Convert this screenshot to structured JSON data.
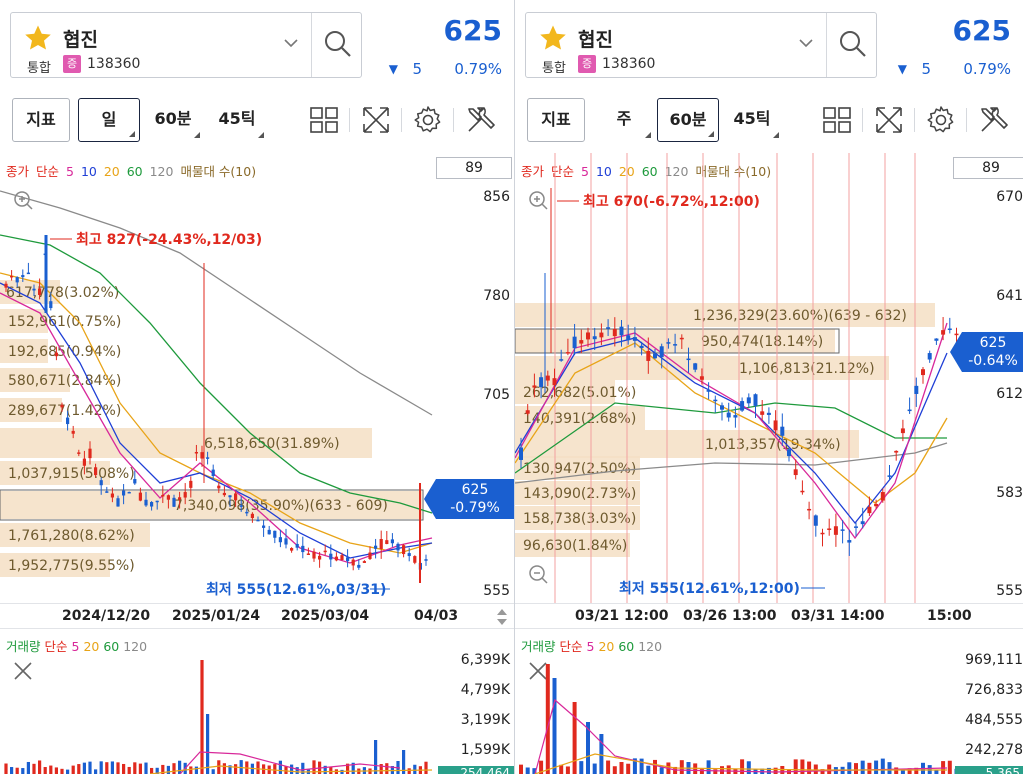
{
  "left": {
    "stock": {
      "name": "협진",
      "market": "통합",
      "badge": "증",
      "code": "138360"
    },
    "price": "625",
    "change_arrow": "▼",
    "change": "5",
    "change_pct": "0.79%",
    "toolbar": {
      "indicator": "지표",
      "period": "일",
      "minute": "60분",
      "tick": "45틱",
      "active": "일"
    },
    "legend": {
      "price": "종가",
      "type": "단순",
      "ma": [
        "5",
        "10",
        "20",
        "60",
        "120"
      ],
      "extra": "매물대 수(10)"
    },
    "count": "89",
    "y_axis": [
      "856",
      "780",
      "705",
      "625",
      "555"
    ],
    "price_tag": [
      "625",
      "-0.79%"
    ],
    "high_label": "최고 827(-24.43%,12/03)",
    "low_label": "최저 555(12.61%,03/31)",
    "profile": [
      "617,778(3.02%)",
      "152,961(0.75%)",
      "192,685(0.94%)",
      "580,671(2.84%)",
      "289,677(1.42%)",
      "6,518,650(31.89%)",
      "1,037,915(5.08%)",
      "7,340,098(35.90%)(633 - 609)",
      "1,761,280(8.62%)",
      "1,952,775(9.55%)"
    ],
    "dates": [
      "2024/12/20",
      "2025/01/24",
      "2025/03/04",
      "04/03"
    ],
    "vol_legend": {
      "label": "거래량",
      "type": "단순",
      "ma": [
        "5",
        "20",
        "60",
        "120"
      ]
    },
    "vol_axis": [
      "6,399K",
      "4,799K",
      "3,199K",
      "1,599K"
    ],
    "vol_tag": "254,464"
  },
  "right": {
    "stock": {
      "name": "협진",
      "market": "통합",
      "badge": "증",
      "code": "138360"
    },
    "price": "625",
    "change_arrow": "▼",
    "change": "5",
    "change_pct": "0.79%",
    "toolbar": {
      "indicator": "지표",
      "period": "주",
      "minute": "60분",
      "tick": "45틱",
      "active": "60분"
    },
    "legend": {
      "price": "종가",
      "type": "단순",
      "ma": [
        "5",
        "10",
        "20",
        "60",
        "120"
      ],
      "extra": "매물대 수(10)"
    },
    "count": "89",
    "y_axis": [
      "670",
      "641",
      "612",
      "583",
      "555"
    ],
    "price_tag": [
      "625",
      "-0.64%"
    ],
    "high_label": "최고 670(-6.72%,12:00)",
    "low_label": "최저 555(12.61%,12:00)",
    "profile": [
      "1,236,329(23.60%)(639 - 632)",
      "950,474(18.14%)",
      "1,106,813(21.12%)",
      "262,682(5.01%)",
      "140,391(2.68%)",
      "1,013,357(19.34%)",
      "130,947(2.50%)",
      "143,090(2.73%)",
      "158,738(3.03%)",
      "96,630(1.84%)"
    ],
    "dates": [
      "03/21 12:00",
      "03/26 13:00",
      "03/31 14:00",
      "15:00"
    ],
    "vol_legend": {
      "label": "거래량",
      "type": "단순",
      "ma": [
        "5",
        "20",
        "60",
        "120"
      ]
    },
    "vol_axis": [
      "969,111",
      "726,833",
      "484,555",
      "242,278"
    ],
    "vol_tag": "5,365"
  },
  "colors": {
    "up": "#e0291e",
    "down": "#1a5fd0",
    "ma5": "#d8289a",
    "ma10": "#1f3fd6",
    "ma20": "#e8a418",
    "ma60": "#1e9a3c",
    "ma120": "#8a8a8a",
    "profile": "#f5dfc4",
    "profile_text": "#6e5a2e",
    "high": "#e0291e",
    "low": "#1a5fd0"
  }
}
